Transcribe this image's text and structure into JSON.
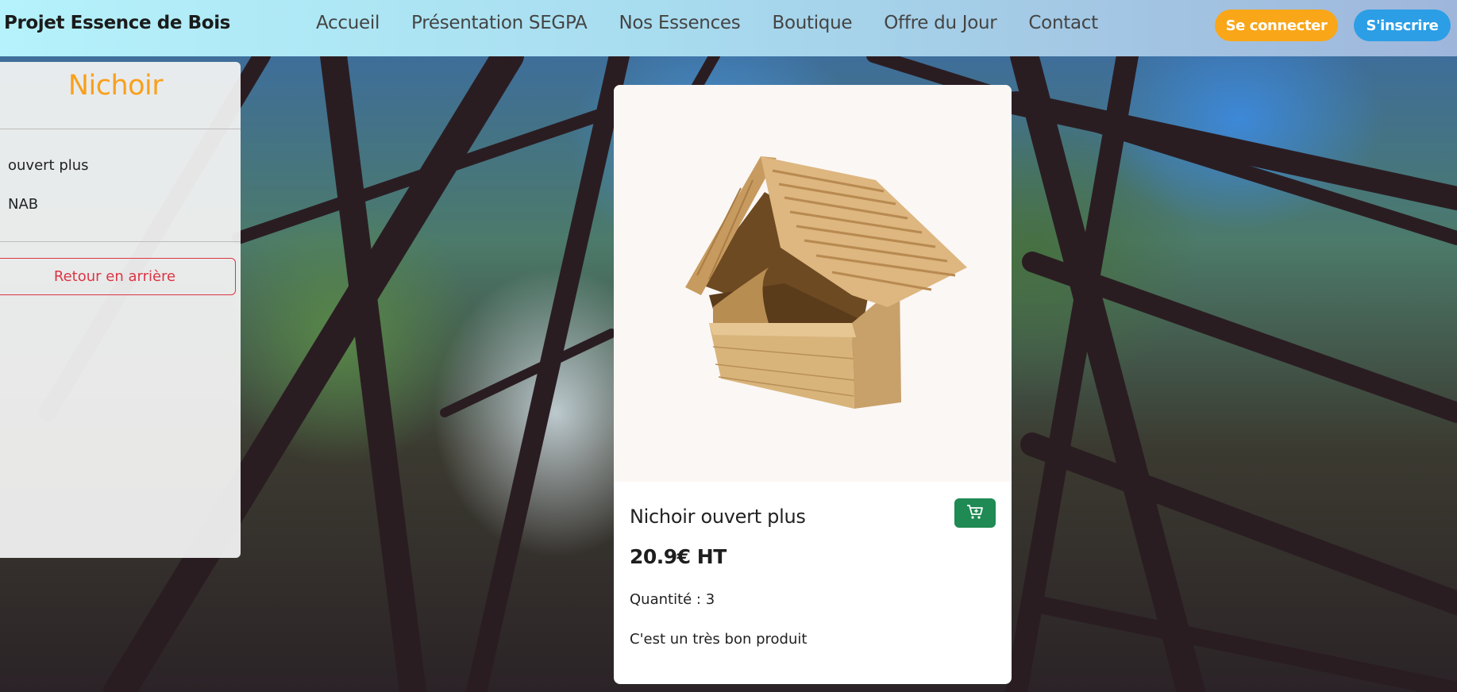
{
  "header": {
    "brand": "Projet Essence de Bois",
    "nav": [
      "Accueil",
      "Présentation SEGPA",
      "Nos Essences",
      "Boutique",
      "Offre du Jour",
      "Contact"
    ],
    "login_label": "Se connecter",
    "signup_label": "S'inscrire"
  },
  "sidebar": {
    "title": "Nichoir",
    "line1": "ouvert plus",
    "line2": "NAB",
    "back_label": "Retour en arrière"
  },
  "product": {
    "title": "Nichoir ouvert plus",
    "price": "20.9€ HT",
    "quantity": "Quantité : 3",
    "description": "C'est un très bon produit",
    "cart_icon": "cart-plus-icon"
  },
  "colors": {
    "accent_orange": "#f9a619",
    "accent_blue": "#2b9ee6",
    "cart_green": "#1f8a53",
    "back_red": "#dc3545"
  }
}
